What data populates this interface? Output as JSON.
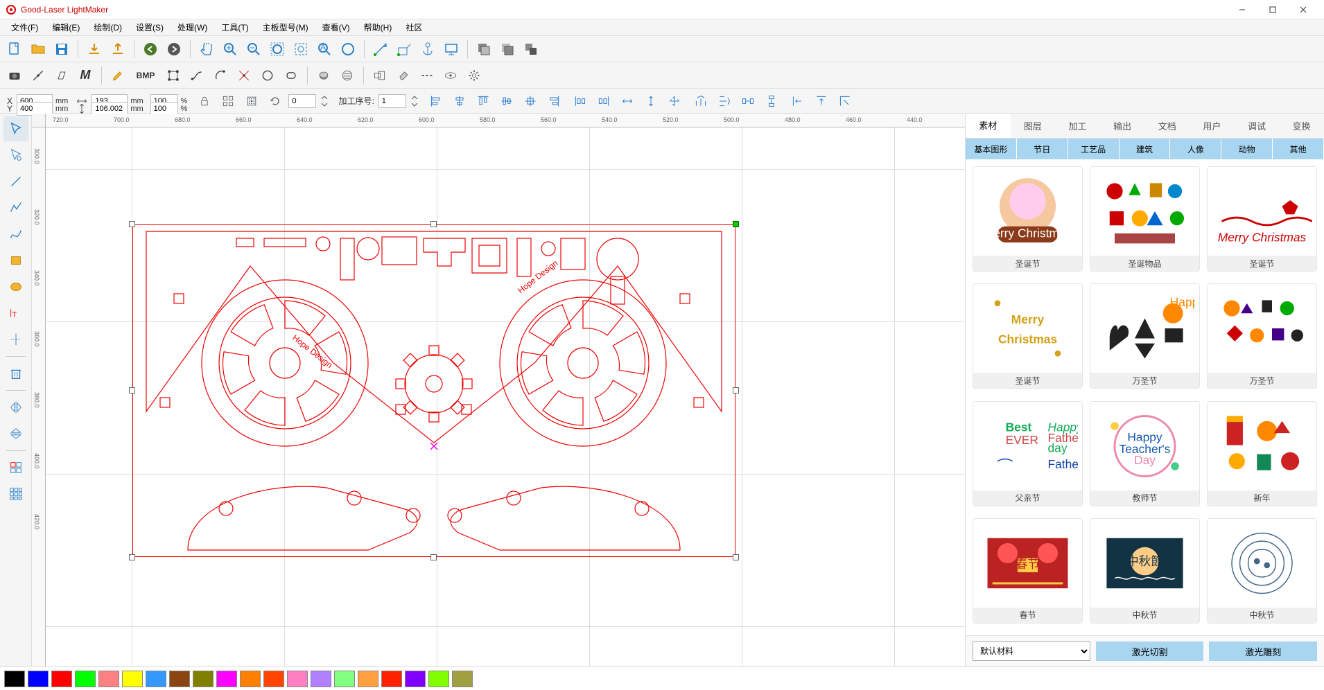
{
  "app": {
    "title": "Good-Laser LightMaker"
  },
  "menu": {
    "file": "文件(F)",
    "edit": "编辑(E)",
    "draw": "绘制(D)",
    "settings": "设置(S)",
    "process": "处理(W)",
    "tools": "工具(T)",
    "mainboard": "主板型号(M)",
    "view": "查看(V)",
    "help": "帮助(H)",
    "community": "社区"
  },
  "props": {
    "x_label": "X",
    "y_label": "Y",
    "x": "600",
    "y": "400",
    "xunit": "mm",
    "yunit": "mm",
    "w": "193",
    "h": "106.002",
    "wunit": "mm",
    "hunit": "mm",
    "wscale": "100",
    "hscale": "100",
    "percent": "%",
    "rot": "0",
    "seq_label": "加工序号:",
    "seq": "1"
  },
  "rtabs": {
    "material": "素材",
    "layer": "图层",
    "process": "加工",
    "output": "输出",
    "document": "文档",
    "user": "用户",
    "debug": "调试",
    "transform": "变换"
  },
  "subcats": {
    "basic": "基本图形",
    "holiday": "节日",
    "craft": "工艺品",
    "building": "建筑",
    "portrait": "人像",
    "animal": "动物",
    "other": "其他"
  },
  "lib": [
    {
      "label": "圣诞节"
    },
    {
      "label": "圣诞物品"
    },
    {
      "label": "圣诞节"
    },
    {
      "label": "圣诞节"
    },
    {
      "label": "万圣节"
    },
    {
      "label": "万圣节"
    },
    {
      "label": "父亲节"
    },
    {
      "label": "教师节"
    },
    {
      "label": "新年"
    },
    {
      "label": "春节"
    },
    {
      "label": "中秋节"
    },
    {
      "label": "中秋节"
    }
  ],
  "rbottom": {
    "material": "默认材料",
    "cut": "激光切割",
    "engrave": "激光雕刻"
  },
  "bmp_label": "BMP",
  "m_label": "M",
  "palette": [
    "#000000",
    "#0000ff",
    "#ff0000",
    "#00ff00",
    "#ff8080",
    "#ffff00",
    "#3399ff",
    "#8b4513",
    "#808000",
    "#ff00ff",
    "#ff7f00",
    "#ff4500",
    "#ff80c0",
    "#b080ff",
    "#80ff80",
    "#ffa040",
    "#ff2200",
    "#8000ff",
    "#80ff00",
    "#a0a040"
  ],
  "ruler_h_ticks": [
    "720.0",
    "700.0",
    "680.0",
    "660.0",
    "640.0",
    "620.0",
    "600.0",
    "580.0",
    "560.0",
    "540.0",
    "520.0",
    "500.0",
    "480.0",
    "460.0",
    "440.0"
  ],
  "ruler_v_ticks": [
    "300.0",
    "320.0",
    "340.0",
    "360.0",
    "380.0",
    "400.0",
    "420.0"
  ]
}
